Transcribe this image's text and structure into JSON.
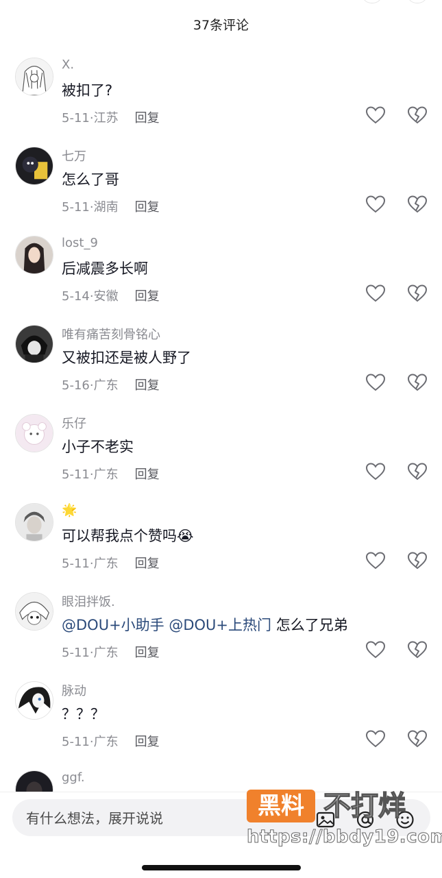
{
  "header": {
    "title": "37条评论"
  },
  "comments": [
    {
      "username": "X.",
      "text": "被扣了?",
      "date": "5-11",
      "location": "江苏",
      "reply_label": "回复"
    },
    {
      "username": "七万",
      "text": "怎么了哥",
      "date": "5-11",
      "location": "湖南",
      "reply_label": "回复"
    },
    {
      "username": "lost_9",
      "text": "后减震多长啊",
      "date": "5-14",
      "location": "安徽",
      "reply_label": "回复"
    },
    {
      "username": "唯有痛苦刻骨铭心",
      "text": "又被扣还是被人野了",
      "date": "5-16",
      "location": "广东",
      "reply_label": "回复"
    },
    {
      "username": "乐仔",
      "text": "小子不老实",
      "date": "5-11",
      "location": "广东",
      "reply_label": "回复"
    },
    {
      "username": "🌟",
      "text": "可以帮我点个赞吗😭",
      "date": "5-11",
      "location": "广东",
      "reply_label": "回复"
    },
    {
      "username": "眼泪拌饭.",
      "mention1": "@DOU+小助手",
      "mention2": "@DOU+上热门",
      "text": "怎么了兄弟",
      "date": "5-11",
      "location": "广东",
      "reply_label": "回复"
    },
    {
      "username": "脉动",
      "text": "？？？",
      "date": "5-11",
      "location": "广东",
      "reply_label": "回复"
    },
    {
      "username": "ggf."
    }
  ],
  "input": {
    "placeholder": "有什么想法，展开说说"
  },
  "watermark": {
    "badge": "黑料",
    "text": "不打烊",
    "url": "https://bbdy19.com"
  },
  "colors": {
    "text": "#161823",
    "secondary": "#8a8b91",
    "mention": "#2b4a7a",
    "input_bg": "#f2f2f4",
    "watermark_badge": "#f0812c"
  },
  "icons": {
    "like": "heart-outline-icon",
    "dislike": "broken-heart-icon",
    "image": "image-icon",
    "emoji": "emoji-icon",
    "mention": "at-icon"
  }
}
